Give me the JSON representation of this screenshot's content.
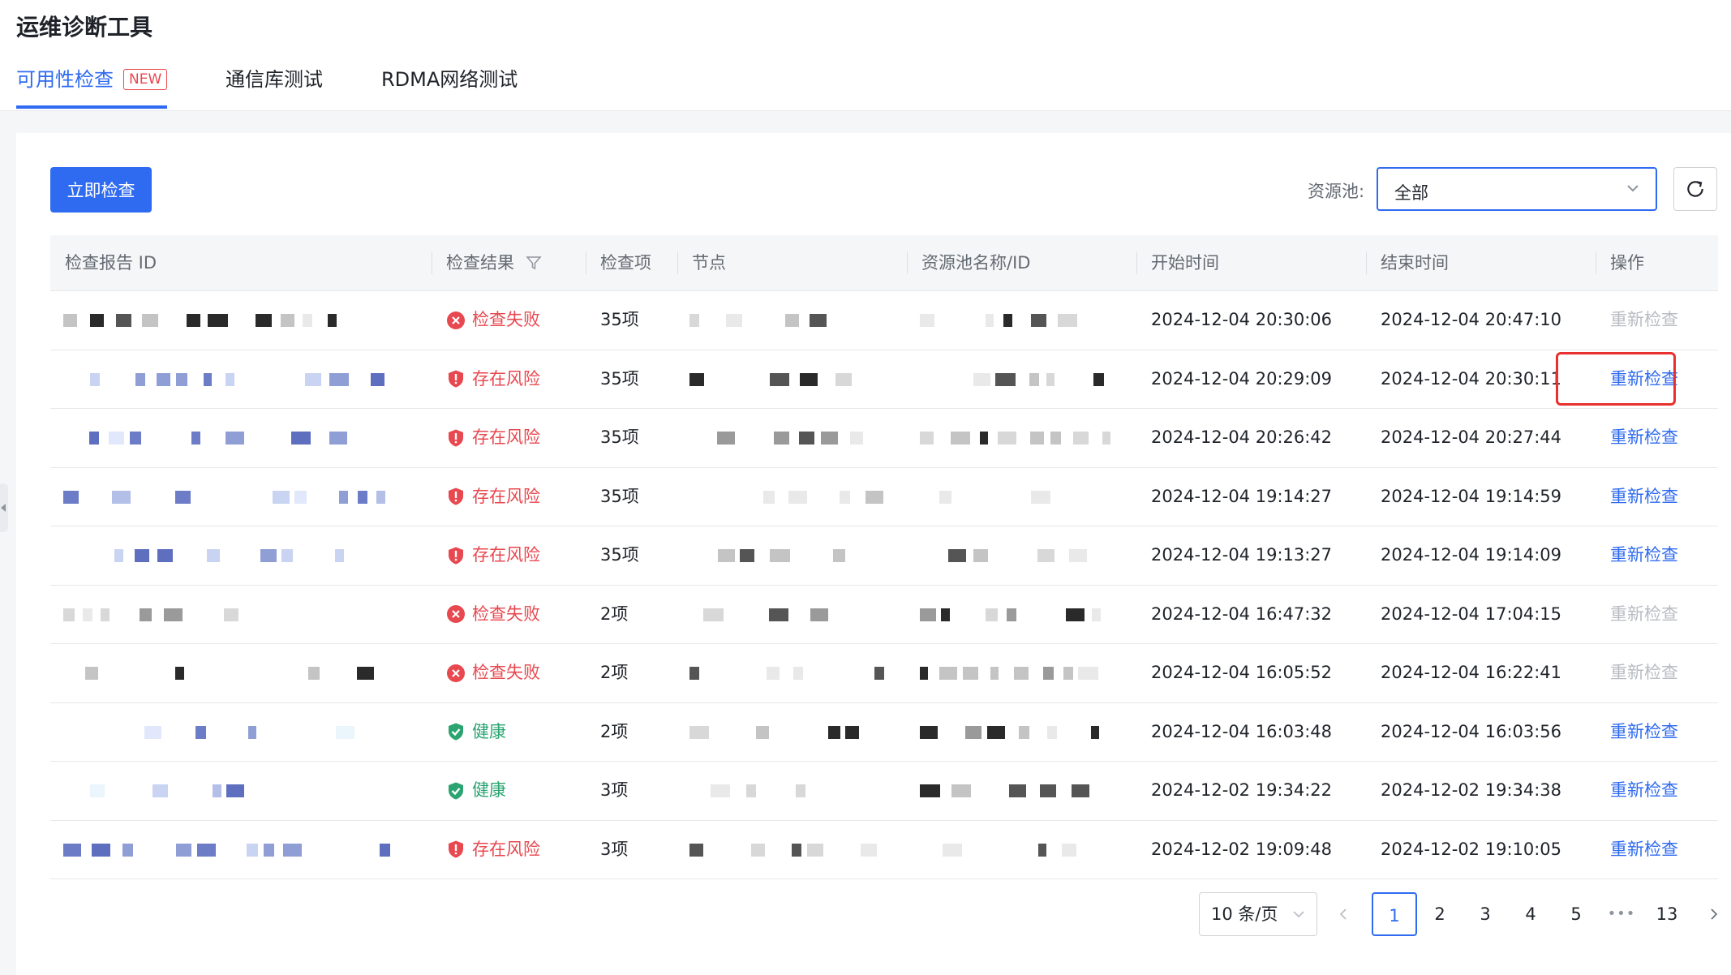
{
  "app": {
    "title": "运维诊断工具"
  },
  "tabs": [
    {
      "label": "可用性检查",
      "badge": "NEW",
      "active": true
    },
    {
      "label": "通信库测试",
      "active": false
    },
    {
      "label": "RDMA网络测试",
      "active": false
    }
  ],
  "toolbar": {
    "primary_button": "立即检查",
    "filter_label": "资源池:",
    "filter_value": "全部"
  },
  "table": {
    "columns": [
      "检查报告 ID",
      "检查结果",
      "检查项",
      "节点",
      "资源池名称/ID",
      "开始时间",
      "结束时间",
      "操作"
    ],
    "rows": [
      {
        "result": "检查失败",
        "status": "fail",
        "items": "35项",
        "start": "2024-12-04 20:30:06",
        "end": "2024-12-04 20:47:10",
        "action": "重新检查",
        "action_enabled": false
      },
      {
        "result": "存在风险",
        "status": "risk",
        "items": "35项",
        "start": "2024-12-04 20:29:09",
        "end": "2024-12-04 20:30:11",
        "action": "重新检查",
        "action_enabled": true
      },
      {
        "result": "存在风险",
        "status": "risk",
        "items": "35项",
        "start": "2024-12-04 20:26:42",
        "end": "2024-12-04 20:27:44",
        "action": "重新检查",
        "action_enabled": true
      },
      {
        "result": "存在风险",
        "status": "risk",
        "items": "35项",
        "start": "2024-12-04 19:14:27",
        "end": "2024-12-04 19:14:59",
        "action": "重新检查",
        "action_enabled": true
      },
      {
        "result": "存在风险",
        "status": "risk",
        "items": "35项",
        "start": "2024-12-04 19:13:27",
        "end": "2024-12-04 19:14:09",
        "action": "重新检查",
        "action_enabled": true
      },
      {
        "result": "检查失败",
        "status": "fail",
        "items": "2项",
        "start": "2024-12-04 16:47:32",
        "end": "2024-12-04 17:04:15",
        "action": "重新检查",
        "action_enabled": false
      },
      {
        "result": "检查失败",
        "status": "fail",
        "items": "2项",
        "start": "2024-12-04 16:05:52",
        "end": "2024-12-04 16:22:41",
        "action": "重新检查",
        "action_enabled": false
      },
      {
        "result": "健康",
        "status": "ok",
        "items": "2项",
        "start": "2024-12-04 16:03:48",
        "end": "2024-12-04 16:03:56",
        "action": "重新检查",
        "action_enabled": true
      },
      {
        "result": "健康",
        "status": "ok",
        "items": "3项",
        "start": "2024-12-02 19:34:22",
        "end": "2024-12-02 19:34:38",
        "action": "重新检查",
        "action_enabled": true
      },
      {
        "result": "存在风险",
        "status": "risk",
        "items": "3项",
        "start": "2024-12-02 19:09:48",
        "end": "2024-12-02 19:10:05",
        "action": "重新检查",
        "action_enabled": true
      }
    ]
  },
  "pagination": {
    "page_size": "10 条/页",
    "pages": [
      "1",
      "2",
      "3",
      "4",
      "5"
    ],
    "ellipsis": "•••",
    "last_page": "13",
    "current": "1"
  },
  "colors": {
    "primary": "#2f6bf0",
    "fail": "#e8484f",
    "risk": "#e8484f",
    "ok": "#2ba471",
    "disabled": "#b8bcc2",
    "highlight": "#e8312e"
  },
  "icons": {
    "fail": "x-circle-icon",
    "risk": "shield-exclamation-icon",
    "ok": "shield-check-icon",
    "filter": "funnel-icon",
    "refresh": "refresh-icon",
    "dropdown": "chevron-down-icon"
  }
}
